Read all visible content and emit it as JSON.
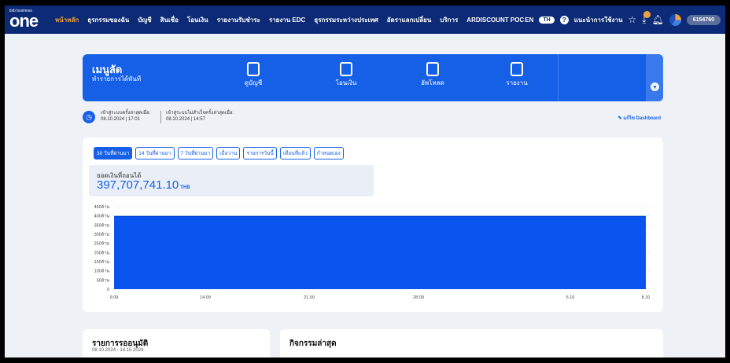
{
  "brand": {
    "small": "tisb business",
    "big": "one"
  },
  "topnav": {
    "items": [
      {
        "label": "หน้าหลัก",
        "active": true
      },
      {
        "label": "ธุรกรรมของฉัน"
      },
      {
        "label": "บัญชี"
      },
      {
        "label": "สินเชื่อ"
      },
      {
        "label": "โอนเงิน"
      },
      {
        "label": "รายงานรับชำระ"
      },
      {
        "label": "รายงาน EDC"
      },
      {
        "label": "ธุรกรรมระหว่างประเทศ"
      },
      {
        "label": "อัตราแลกเปลี่ยน"
      },
      {
        "label": "บริการ"
      },
      {
        "label": "ARDISCOUNT POC"
      }
    ],
    "lang_en": "EN",
    "lang_th": "TH",
    "help": "?",
    "guide": "แนะนำการใช้งาน",
    "account": "6154760"
  },
  "menu_card": {
    "title": "เมนูลัด",
    "subtitle": "ทำรายการได้ทันที",
    "items": [
      {
        "label": "ดูบัญชี",
        "icon": "account-doc-icon"
      },
      {
        "label": "โอนเงิน",
        "icon": "transfer-icon"
      },
      {
        "label": "อัพโหลด",
        "icon": "upload-icon"
      },
      {
        "label": "รายงาน",
        "icon": "report-icon"
      }
    ],
    "scroll_icon": "▾"
  },
  "login": {
    "last_success_label": "เข้าสู่ระบบครั้งล่าสุดเมื่อ:",
    "last_success_time": "08.10.2024 | 17:01",
    "last_fail_label": "เข้าสู่ระบบไม่สำเร็จครั้งล่าสุดเมื่อ:",
    "last_fail_time": "08.10.2024 | 14:57",
    "edit_dashboard": "✎ แก้ไข Dashboard"
  },
  "filters": [
    {
      "label": "30 วันที่ผ่านมา",
      "active": true
    },
    {
      "label": "14 วันที่ผ่านมา"
    },
    {
      "label": "7 วันที่ผ่านมา"
    },
    {
      "label": "เมื่อวาน"
    },
    {
      "label": "รายการวันนี้"
    },
    {
      "label": "เดือนที่แล้ว"
    },
    {
      "label": "กำหนดเอง"
    }
  ],
  "balance": {
    "label": "ยอดเงินที่ถอนได้",
    "amount": "397,707,741.10",
    "currency": "THB"
  },
  "chart_data": {
    "type": "area",
    "x": [
      "9.09",
      "14.09",
      "21.09",
      "28.09",
      "5.10",
      "8.10"
    ],
    "y_ticks": [
      "0",
      "50ล้าน",
      "100ล้าน",
      "150ล้าน",
      "200ล้าน",
      "250ล้าน",
      "300ล้าน",
      "350ล้าน",
      "400ล้าน",
      "450ล้าน"
    ],
    "ylim": [
      0,
      450000000
    ],
    "series": [
      {
        "values": [
          397707741.1,
          397707741.1,
          397707741.1,
          397707741.1,
          397707741.1,
          397707741.1
        ]
      }
    ],
    "color": "#0a55ef",
    "grid": true
  },
  "approvals_card": {
    "title": "รายการรออนุมัติ",
    "subtitle": "08.10.2024 - 14.10.2024"
  },
  "activity_card": {
    "title": "กิจกรรมล่าสุด"
  }
}
